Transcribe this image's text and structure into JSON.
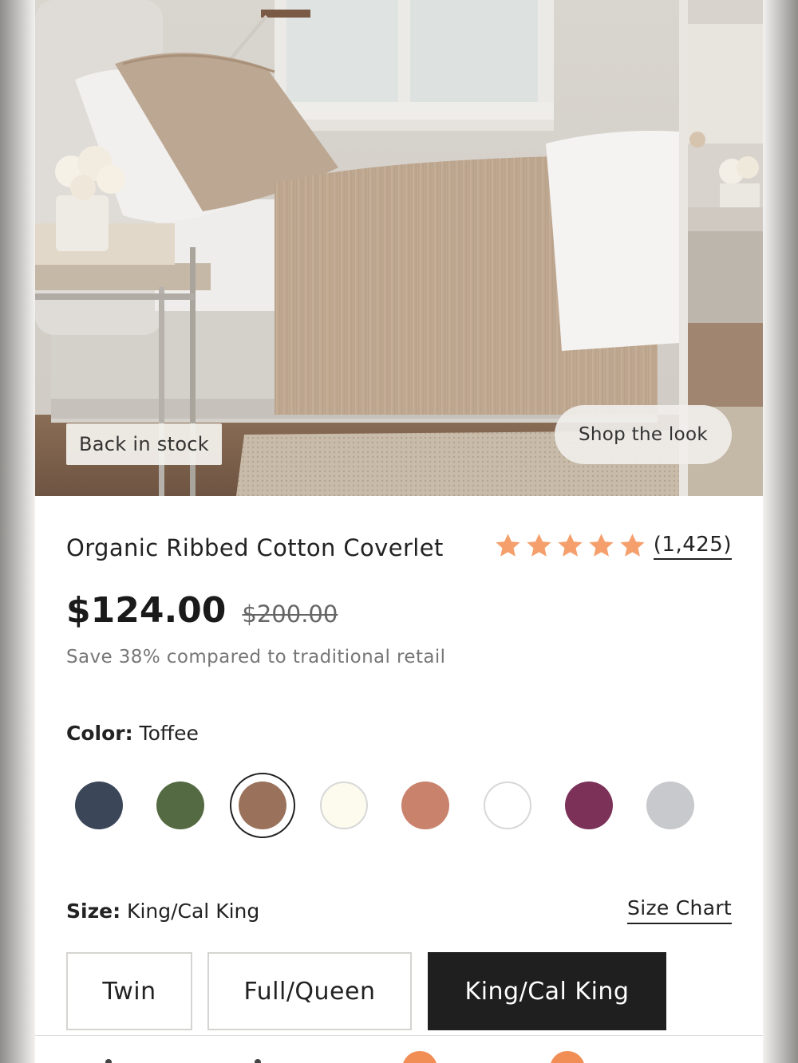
{
  "hero": {
    "badge": "Back in stock",
    "shop_the_look": "Shop the look"
  },
  "product": {
    "title": "Organic Ribbed Cotton Coverlet",
    "rating": 5,
    "review_count": "(1,425)",
    "price": "$124.00",
    "original_price": "$200.00",
    "savings_text": "Save 38% compared to traditional retail"
  },
  "color": {
    "label": "Color:",
    "selected": "Toffee",
    "swatches": [
      "#3b4659",
      "#546a43",
      "#9a725b",
      "#fcfbee",
      "#c9826c",
      "#ffffff",
      "#7c3158",
      "#c8c9cc"
    ],
    "selected_index": 2
  },
  "size": {
    "label": "Size:",
    "selected": "King/Cal King",
    "chart_link": "Size Chart",
    "options": [
      "Twin",
      "Full/Queen",
      "King/Cal King"
    ]
  },
  "colors": {
    "star": "#f5a06c",
    "accent_badge": "#f08e55"
  }
}
